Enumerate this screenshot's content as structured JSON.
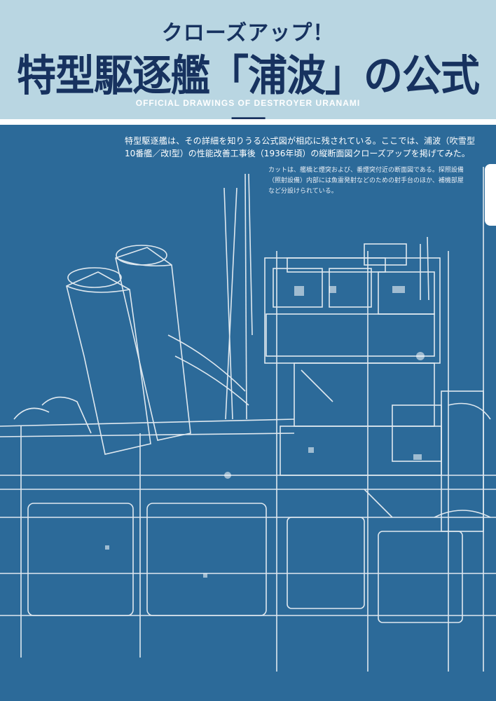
{
  "header": {
    "kicker": "クローズアップ！",
    "title": "特型駆逐艦「浦波」の公式図",
    "subtitle": "OFFICIAL DRAWINGS OF DESTROYER URANAMI"
  },
  "article": {
    "lead": "特型駆逐艦は、その詳細を知りうる公式図が相応に残されている。ここでは、浦波（吹雪型10番艦／改Ⅰ型）の性能改善工事後（1936年頃）の縦断面図クローズアップを掲げてみた。",
    "caption": "カットは、艦橋と煙突および、番煙突付近の断面図である。探照設備（照射設備）内部には魚雷発射などのための射手台のほか、補機部屋など分設けられている。"
  },
  "colors": {
    "header_bg": "#b9d6e2",
    "title_navy": "#17325f",
    "blueprint_bg": "#2c6a99",
    "line_white": "#ffffff"
  }
}
